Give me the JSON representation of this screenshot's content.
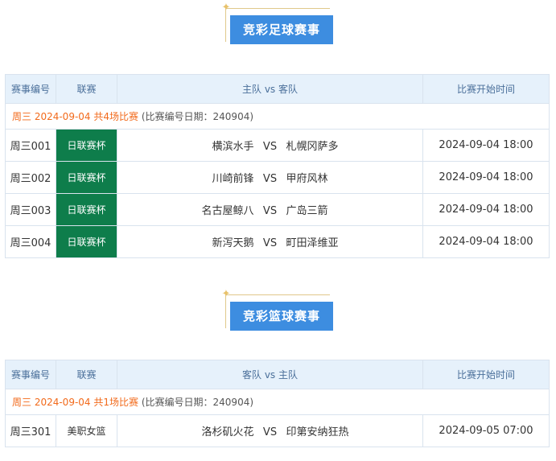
{
  "football": {
    "banner_title": "竞彩足球赛事",
    "headers": [
      "赛事编号",
      "联赛",
      "主队 vs 客队",
      "比赛开始时间"
    ],
    "date_line": {
      "highlight": "周三 2024-09-04 共4场比赛",
      "note": "(比赛编号日期：240904)"
    },
    "matches": [
      {
        "id": "周三001",
        "league": "日联赛杯",
        "left": "横滨水手",
        "vs": "VS",
        "right": "札幌冈萨多",
        "time": "2024-09-04 18:00"
      },
      {
        "id": "周三002",
        "league": "日联赛杯",
        "left": "川崎前锋",
        "vs": "VS",
        "right": "甲府风林",
        "time": "2024-09-04 18:00"
      },
      {
        "id": "周三003",
        "league": "日联赛杯",
        "left": "名古屋鲸八",
        "vs": "VS",
        "right": "广岛三箭",
        "time": "2024-09-04 18:00"
      },
      {
        "id": "周三004",
        "league": "日联赛杯",
        "left": "新泻天鹅",
        "vs": "VS",
        "right": "町田泽维亚",
        "time": "2024-09-04 18:00"
      }
    ],
    "league_color": "#0e7d4b"
  },
  "basketball": {
    "banner_title": "竞彩篮球赛事",
    "headers": [
      "赛事编号",
      "联赛",
      "客队 vs 主队",
      "比赛开始时间"
    ],
    "date_line": {
      "highlight": "周三 2024-09-04 共1场比赛",
      "note": "(比赛编号日期：240904)"
    },
    "matches": [
      {
        "id": "周三301",
        "league": "美职女篮",
        "left": "洛杉矶火花",
        "vs": "VS",
        "right": "印第安纳狂热",
        "time": "2024-09-05 07:00"
      }
    ]
  },
  "colors": {
    "banner": "#3d8de0",
    "highlight": "#f26a1b",
    "header_bg": "#e6f1fb"
  },
  "icons": {
    "banner_decoration": "star-icon"
  }
}
